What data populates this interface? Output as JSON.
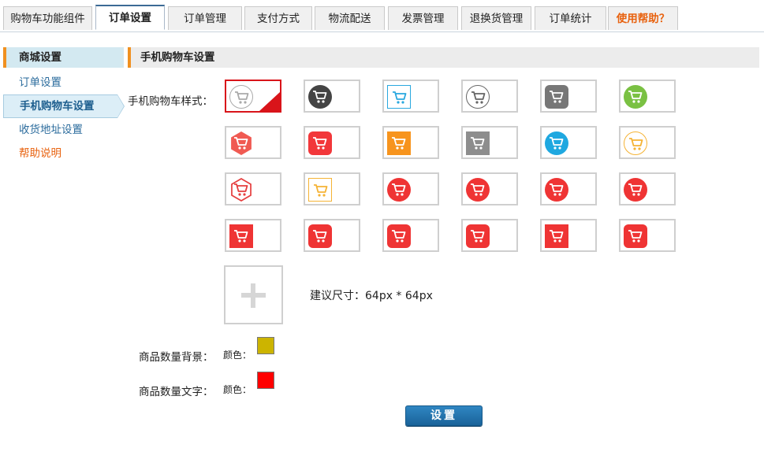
{
  "tabs": [
    {
      "label": "购物车功能组件"
    },
    {
      "label": "订单设置"
    },
    {
      "label": "订单管理"
    },
    {
      "label": "支付方式"
    },
    {
      "label": "物流配送"
    },
    {
      "label": "发票管理"
    },
    {
      "label": "退换货管理"
    },
    {
      "label": "订单统计"
    },
    {
      "label": "使用帮助？"
    }
  ],
  "sidebar": {
    "heading": "商城设置",
    "items": [
      {
        "label": "订单设置"
      },
      {
        "label": "手机购物车设置"
      },
      {
        "label": "收货地址设置"
      },
      {
        "label": "帮助说明"
      }
    ]
  },
  "section": {
    "title": "手机购物车设置"
  },
  "form": {
    "cart_style_label": "手机购物车样式：",
    "size_hint": "建议尺寸：64px * 64px",
    "count_bg_label": "商品数量背景：",
    "count_text_label": "商品数量文字：",
    "color_label": "颜色：",
    "count_bg_color": "#ccb400",
    "count_text_color": "#ff0000",
    "submit_label": "设置"
  },
  "cart_styles": [
    {
      "shape": "circle-outline",
      "color": "#aaaaaa",
      "selected": true
    },
    {
      "shape": "circle",
      "color": "#444444"
    },
    {
      "shape": "square-outline",
      "color": "#29a8df"
    },
    {
      "shape": "circle-outline",
      "color": "#666666"
    },
    {
      "shape": "rounded",
      "color": "#777777"
    },
    {
      "shape": "circle",
      "color": "#7ac143"
    },
    {
      "shape": "hexagon",
      "color": "#f05a52"
    },
    {
      "shape": "rounded",
      "color": "#f2373a"
    },
    {
      "shape": "square",
      "color": "#f7941d"
    },
    {
      "shape": "square",
      "color": "#8d8d8d"
    },
    {
      "shape": "circle",
      "color": "#1fa8e0"
    },
    {
      "shape": "circle-outline",
      "color": "#f5b335"
    },
    {
      "shape": "hexagon-outline",
      "color": "#e53e3e"
    },
    {
      "shape": "square-outline",
      "color": "#f5b335"
    },
    {
      "shape": "circle",
      "color": "#ef3434"
    },
    {
      "shape": "circle",
      "color": "#ef3434"
    },
    {
      "shape": "circle",
      "color": "#ef3434"
    },
    {
      "shape": "circle",
      "color": "#ef3434"
    },
    {
      "shape": "square",
      "color": "#ef3434"
    },
    {
      "shape": "rounded",
      "color": "#ef3434"
    },
    {
      "shape": "rounded",
      "color": "#ef3434"
    },
    {
      "shape": "rounded",
      "color": "#ef3434"
    },
    {
      "shape": "square",
      "color": "#ef3434"
    },
    {
      "shape": "rounded",
      "color": "#ef3434"
    }
  ]
}
